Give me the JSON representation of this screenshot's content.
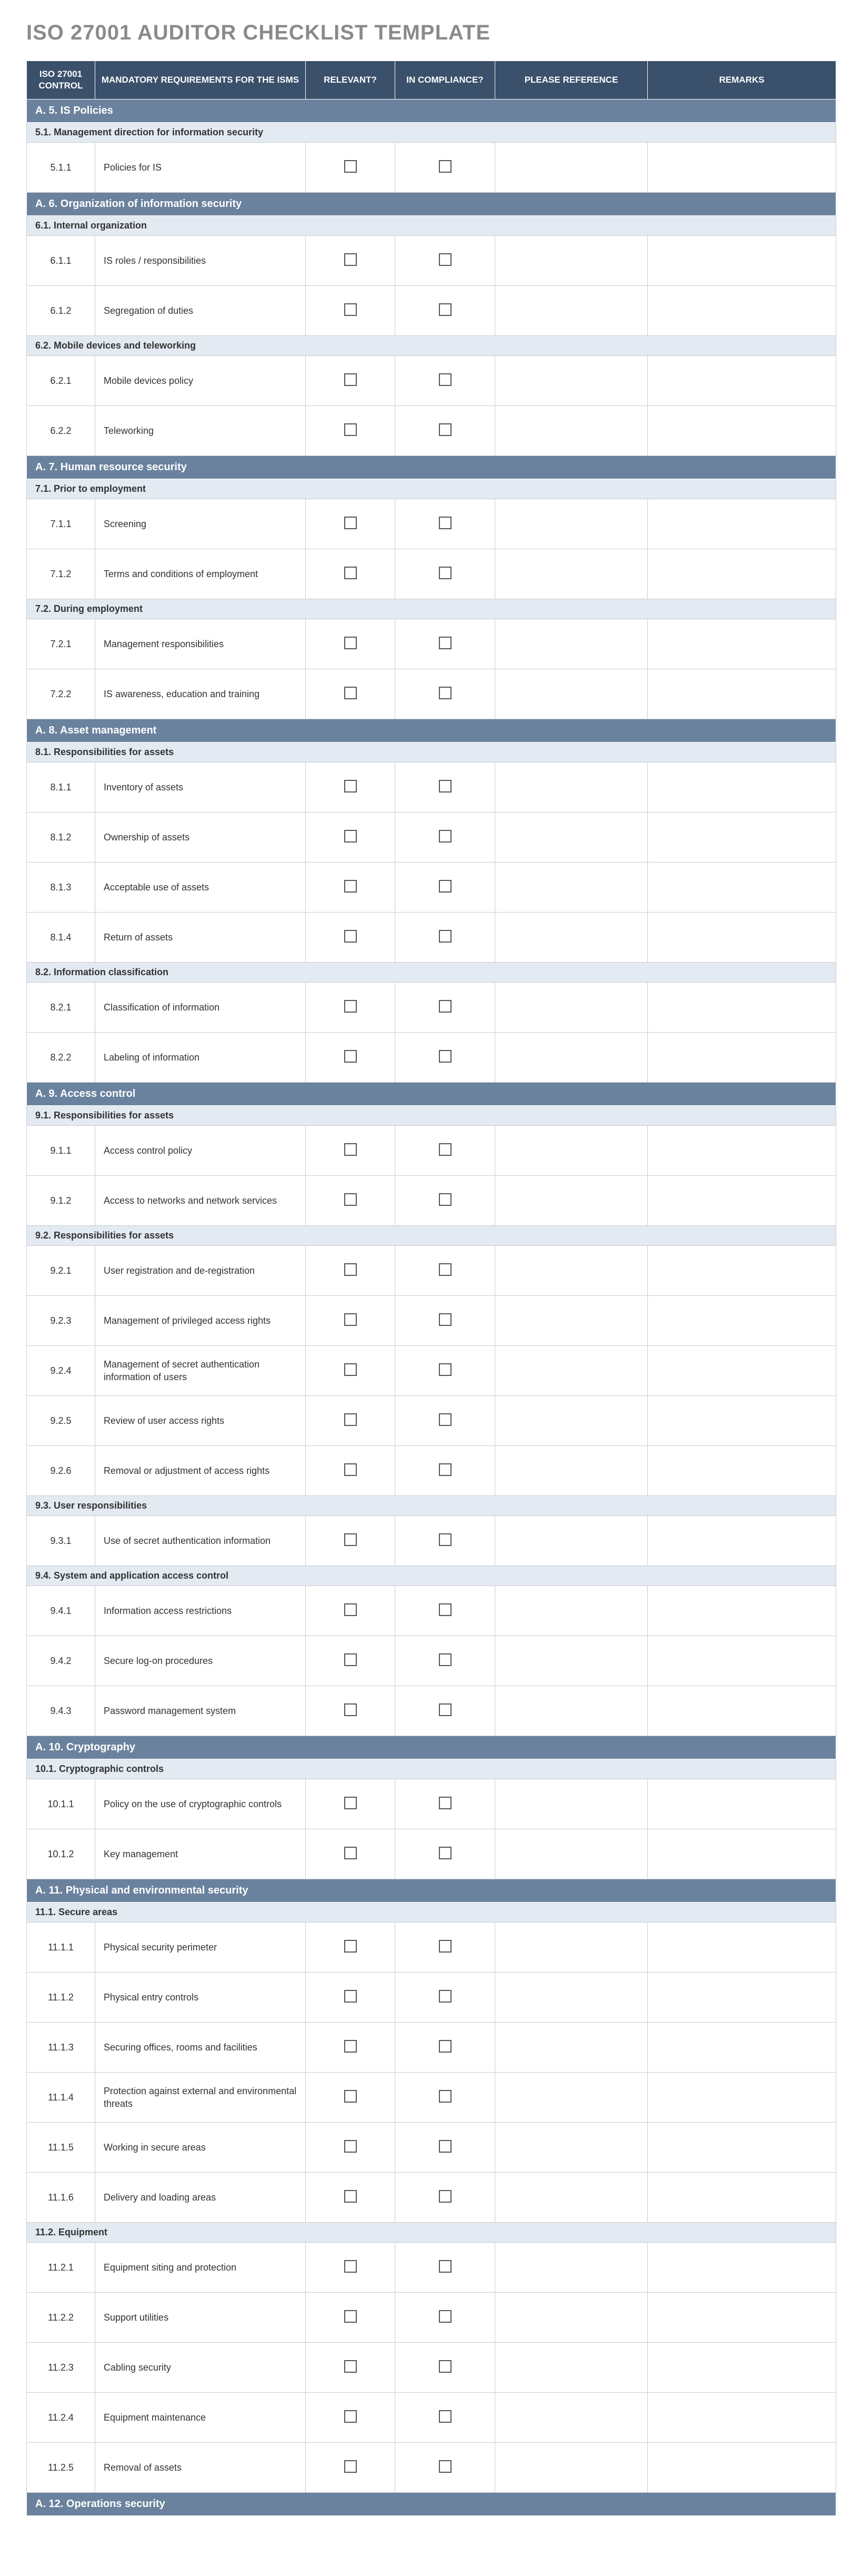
{
  "title": "ISO 27001 AUDITOR CHECKLIST TEMPLATE",
  "headers": {
    "control": "ISO 27001 CONTROL",
    "requirements": "MANDATORY REQUIREMENTS FOR THE ISMS",
    "relevant": "RELEVANT?",
    "compliance": "IN COMPLIANCE?",
    "reference": "PLEASE REFERENCE",
    "remarks": "REMARKS"
  },
  "sections": [
    {
      "label": "A. 5. IS Policies",
      "subsections": [
        {
          "label": "5.1. Management direction for information security",
          "items": [
            {
              "code": "5.1.1",
              "req": "Policies for IS"
            }
          ]
        }
      ]
    },
    {
      "label": "A. 6. Organization of information security",
      "subsections": [
        {
          "label": "6.1. Internal organization",
          "items": [
            {
              "code": "6.1.1",
              "req": "IS roles / responsibilities"
            },
            {
              "code": "6.1.2",
              "req": "Segregation of duties"
            }
          ]
        },
        {
          "label": "6.2. Mobile devices and teleworking",
          "items": [
            {
              "code": "6.2.1",
              "req": "Mobile devices policy"
            },
            {
              "code": "6.2.2",
              "req": "Teleworking"
            }
          ]
        }
      ]
    },
    {
      "label": "A. 7. Human resource security",
      "subsections": [
        {
          "label": "7.1. Prior to employment",
          "items": [
            {
              "code": "7.1.1",
              "req": "Screening"
            },
            {
              "code": "7.1.2",
              "req": "Terms and conditions of employment"
            }
          ]
        },
        {
          "label": "7.2. During employment",
          "items": [
            {
              "code": "7.2.1",
              "req": "Management responsibilities"
            },
            {
              "code": "7.2.2",
              "req": "IS awareness, education and training"
            }
          ]
        }
      ]
    },
    {
      "label": "A. 8. Asset management",
      "subsections": [
        {
          "label": "8.1. Responsibilities for assets",
          "items": [
            {
              "code": "8.1.1",
              "req": "Inventory of assets"
            },
            {
              "code": "8.1.2",
              "req": "Ownership of assets"
            },
            {
              "code": "8.1.3",
              "req": "Acceptable use of assets"
            },
            {
              "code": "8.1.4",
              "req": "Return of assets"
            }
          ]
        },
        {
          "label": "8.2. Information classification",
          "items": [
            {
              "code": "8.2.1",
              "req": "Classification of information"
            },
            {
              "code": "8.2.2",
              "req": "Labeling of information"
            }
          ]
        }
      ]
    },
    {
      "label": "A. 9. Access control",
      "subsections": [
        {
          "label": "9.1. Responsibilities for assets",
          "items": [
            {
              "code": "9.1.1",
              "req": "Access control policy"
            },
            {
              "code": "9.1.2",
              "req": "Access to networks and network services"
            }
          ]
        },
        {
          "label": "9.2. Responsibilities for assets",
          "items": [
            {
              "code": "9.2.1",
              "req": "User registration and de-registration"
            },
            {
              "code": "9.2.3",
              "req": "Management of privileged access rights"
            },
            {
              "code": "9.2.4",
              "req": "Management of secret authentication information of users"
            },
            {
              "code": "9.2.5",
              "req": "Review of user access rights"
            },
            {
              "code": "9.2.6",
              "req": "Removal or adjustment of access rights"
            }
          ]
        },
        {
          "label": "9.3. User responsibilities",
          "items": [
            {
              "code": "9.3.1",
              "req": "Use of secret authentication information"
            }
          ]
        },
        {
          "label": "9.4. System and application access control",
          "items": [
            {
              "code": "9.4.1",
              "req": "Information access restrictions"
            },
            {
              "code": "9.4.2",
              "req": "Secure log-on procedures"
            },
            {
              "code": "9.4.3",
              "req": "Password management system"
            }
          ]
        }
      ]
    },
    {
      "label": "A. 10. Cryptography",
      "subsections": [
        {
          "label": "10.1. Cryptographic controls",
          "items": [
            {
              "code": "10.1.1",
              "req": "Policy on the use of cryptographic controls"
            },
            {
              "code": "10.1.2",
              "req": "Key management"
            }
          ]
        }
      ]
    },
    {
      "label": "A. 11. Physical and environmental security",
      "subsections": [
        {
          "label": "11.1. Secure areas",
          "items": [
            {
              "code": "11.1.1",
              "req": "Physical security perimeter"
            },
            {
              "code": "11.1.2",
              "req": "Physical entry controls"
            },
            {
              "code": "11.1.3",
              "req": "Securing offices, rooms and facilities"
            },
            {
              "code": "11.1.4",
              "req": "Protection against external and environmental threats"
            },
            {
              "code": "11.1.5",
              "req": "Working in secure areas"
            },
            {
              "code": "11.1.6",
              "req": "Delivery and loading areas"
            }
          ]
        },
        {
          "label": "11.2. Equipment",
          "items": [
            {
              "code": "11.2.1",
              "req": "Equipment siting and protection"
            },
            {
              "code": "11.2.2",
              "req": "Support utilities"
            },
            {
              "code": "11.2.3",
              "req": "Cabling security"
            },
            {
              "code": "11.2.4",
              "req": "Equipment maintenance"
            },
            {
              "code": "11.2.5",
              "req": "Removal of assets"
            }
          ]
        }
      ]
    },
    {
      "label": "A. 12. Operations security",
      "subsections": []
    }
  ]
}
